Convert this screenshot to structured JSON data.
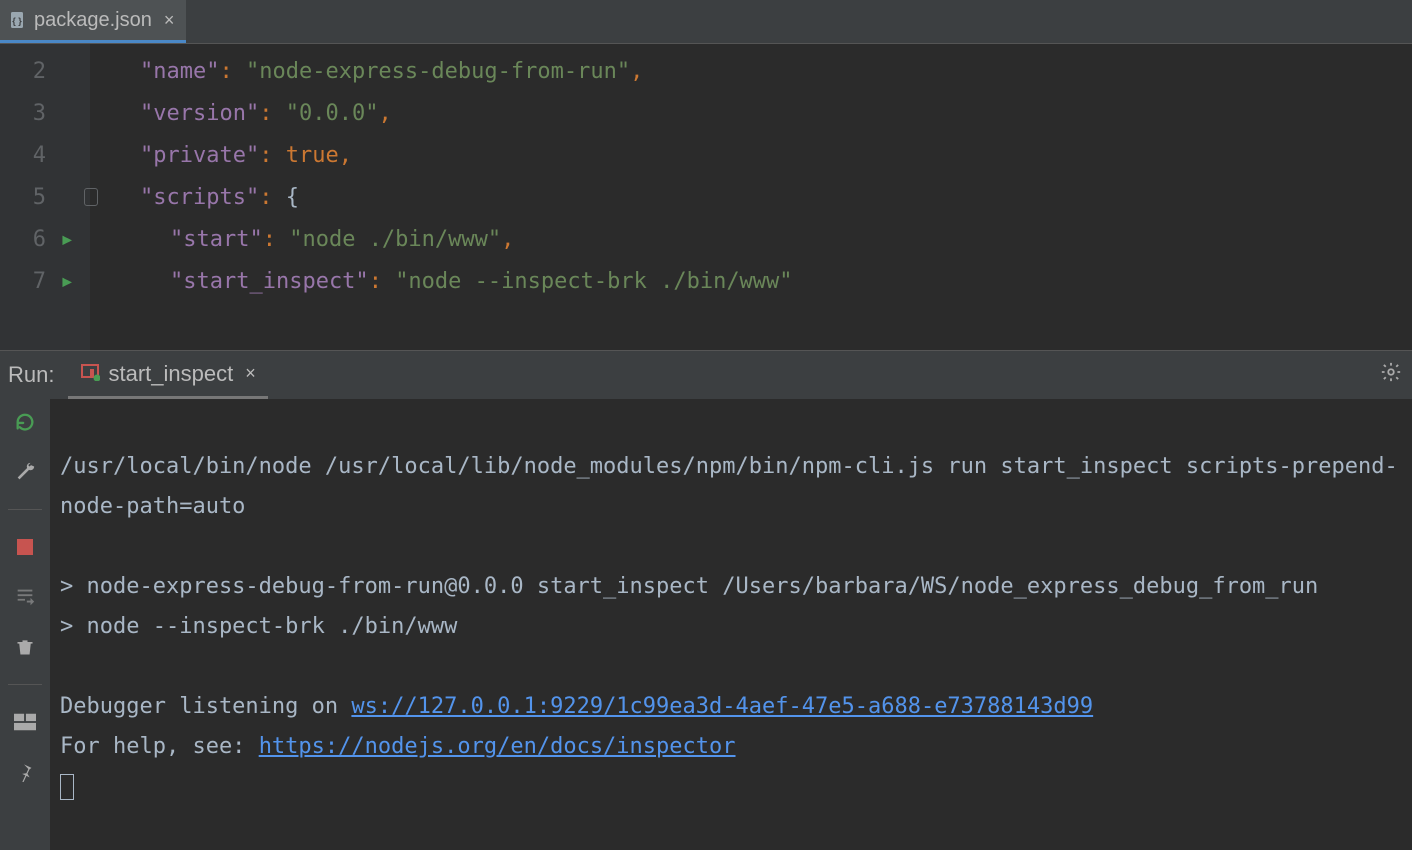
{
  "editor": {
    "tab": {
      "filename": "package.json"
    },
    "line_numbers": [
      "2",
      "3",
      "4",
      "5",
      "6",
      "7"
    ],
    "json": {
      "name_key": "\"name\"",
      "name_val": "\"node-express-debug-from-run\"",
      "version_key": "\"version\"",
      "version_val": "\"0.0.0\"",
      "private_key": "\"private\"",
      "private_val": "true",
      "scripts_key": "\"scripts\"",
      "start_key": "\"start\"",
      "start_val": "\"node ./bin/www\"",
      "start_inspect_key": "\"start_inspect\"",
      "start_inspect_val": "\"node --inspect-brk ./bin/www\"",
      "colon": ":",
      "colon_sp": ": ",
      "comma": ",",
      "lbrace": "{"
    }
  },
  "run": {
    "label": "Run:",
    "tab_name": "start_inspect",
    "console": {
      "cmd1": "/usr/local/bin/node /usr/local/lib/node_modules/npm/bin/npm-cli.js run start_inspect scripts-prepend-node-path=auto",
      "line2": "> node-express-debug-from-run@0.0.0 start_inspect /Users/barbara/WS/node_express_debug_from_run",
      "line3": "> node --inspect-brk ./bin/www",
      "dbg_text": "Debugger listening on ",
      "dbg_link": "ws://127.0.0.1:9229/1c99ea3d-4aef-47e5-a688-e73788143d99",
      "help_text": "For help, see: ",
      "help_link": "https://nodejs.org/en/docs/inspector"
    }
  }
}
